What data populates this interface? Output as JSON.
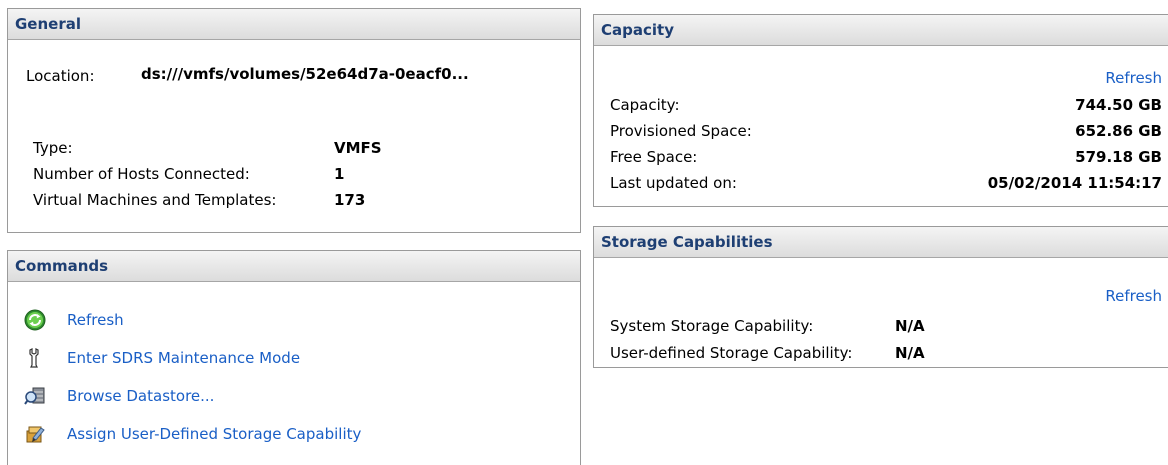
{
  "general": {
    "title": "General",
    "location_label": "Location:",
    "location_value": "ds:///vmfs/volumes/52e64d7a-0eacf0...",
    "type_label": "Type:",
    "type_value": "VMFS",
    "hosts_label": "Number of Hosts Connected:",
    "hosts_value": "1",
    "vms_label": "Virtual Machines and Templates:",
    "vms_value": "173"
  },
  "commands": {
    "title": "Commands",
    "items": [
      {
        "label": "Refresh",
        "icon": "refresh-icon"
      },
      {
        "label": "Enter SDRS Maintenance Mode",
        "icon": "wrench-icon"
      },
      {
        "label": "Browse Datastore...",
        "icon": "browse-datastore-icon"
      },
      {
        "label": "Assign User-Defined Storage Capability",
        "icon": "assign-capability-icon"
      }
    ]
  },
  "capacity": {
    "title": "Capacity",
    "refresh_label": "Refresh",
    "capacity_label": "Capacity:",
    "capacity_value": "744.50 GB",
    "provisioned_label": "Provisioned Space:",
    "provisioned_value": "652.86 GB",
    "free_label": "Free Space:",
    "free_value": "579.18 GB",
    "updated_label": "Last updated on:",
    "updated_value": "05/02/2014 11:54:17"
  },
  "storage": {
    "title": "Storage Capabilities",
    "refresh_label": "Refresh",
    "system_label": "System Storage Capability:",
    "system_value": "N/A",
    "user_label": "User-defined Storage Capability:",
    "user_value": "N/A"
  },
  "colors": {
    "header_text": "#1e3f73",
    "link": "#1a5fc6",
    "border": "#9a9a9a"
  }
}
